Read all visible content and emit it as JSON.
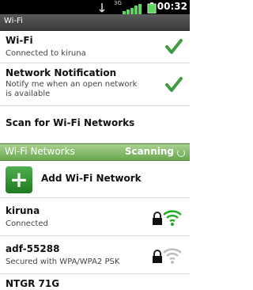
{
  "status_bar": {
    "time": "00:32",
    "network_type": "3G"
  },
  "title_bar": {
    "title": "Wi-Fi"
  },
  "settings": {
    "wifi": {
      "title": "Wi-Fi",
      "summary": "Connected to kiruna",
      "checked": true
    },
    "network_notification": {
      "title": "Network Notification",
      "summary": "Notify me when an open network is available",
      "checked": true
    },
    "scan": {
      "title": "Scan for Wi-Fi Networks"
    }
  },
  "networks_section": {
    "label": "Wi-Fi Networks",
    "status": "Scanning"
  },
  "add_network": {
    "label": "Add Wi-Fi Network",
    "icon": "plus-icon"
  },
  "networks": [
    {
      "name": "kiruna",
      "status": "Connected",
      "secured": true,
      "signal": "full",
      "signal_color": "#22aa22"
    },
    {
      "name": "adf-55288",
      "status": "Secured with WPA/WPA2 PSK",
      "secured": true,
      "signal": "medium",
      "signal_color": "#bdbdbd"
    },
    {
      "name": "NTGR 71G",
      "status": "",
      "secured": false,
      "signal": "weak",
      "signal_color": "#bdbdbd"
    }
  ],
  "colors": {
    "section_green": "#6aa84f",
    "check_green": "#3f9b3f"
  }
}
